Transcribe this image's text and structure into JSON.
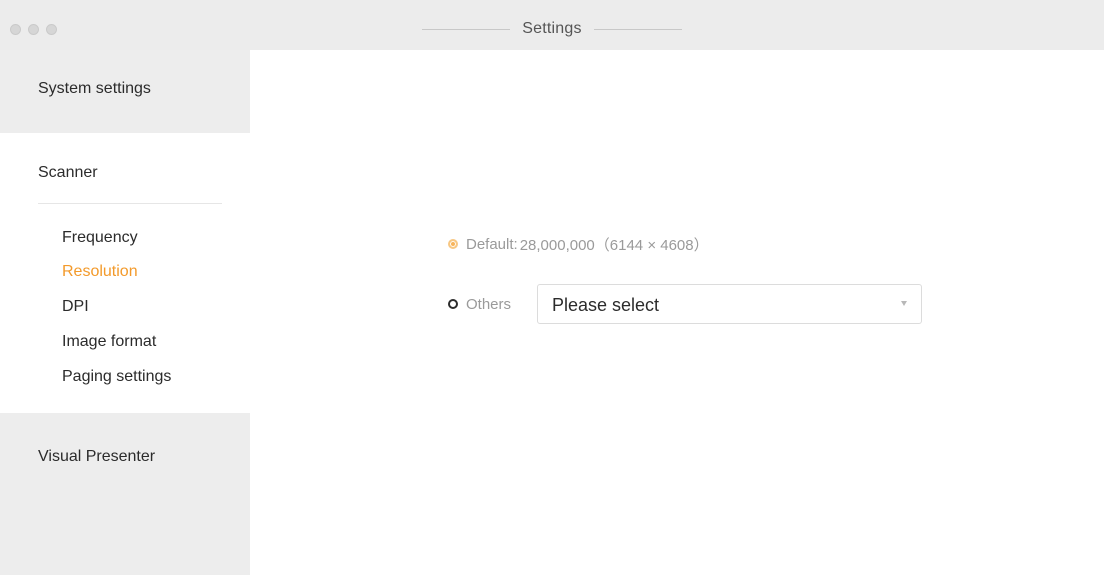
{
  "window": {
    "title": "Settings"
  },
  "sidebar": {
    "sections": [
      {
        "label": "System settings"
      },
      {
        "label": "Scanner",
        "items": [
          {
            "label": "Frequency",
            "active": false
          },
          {
            "label": "Resolution",
            "active": true
          },
          {
            "label": "DPI",
            "active": false
          },
          {
            "label": "Image format",
            "active": false
          },
          {
            "label": "Paging settings",
            "active": false
          }
        ]
      },
      {
        "label": "Visual Presenter"
      }
    ]
  },
  "resolution": {
    "default_label": "Default:",
    "default_value": "28,000,000（6144 × 4608）",
    "default_selected": true,
    "others_label": "Others",
    "others_selected": false,
    "select_value": "Please select"
  },
  "colors": {
    "accent": "#f39a2b",
    "sidebar_bg": "#ededed",
    "titlebar_bg": "#ececec"
  },
  "icons": {
    "default_radio": "radio-checked-icon",
    "others_radio": "radio-unchecked-icon",
    "select_arrow": "chevron-down-icon"
  }
}
